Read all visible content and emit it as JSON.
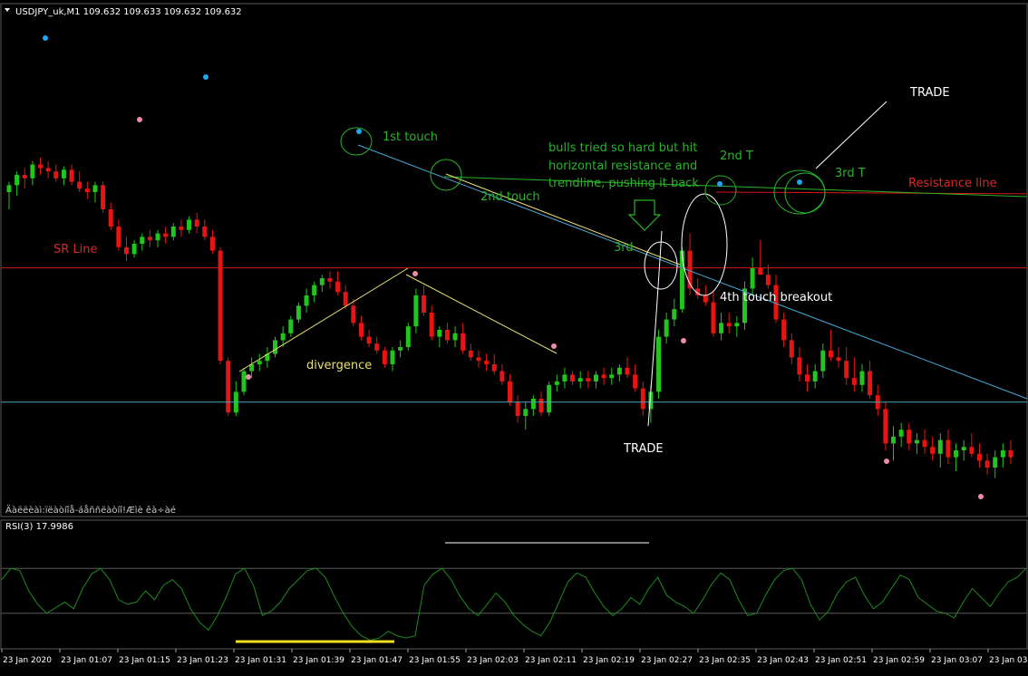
{
  "header": {
    "title": "USDJPY_uk,M1  109.632 109.633 109.632 109.632",
    "footer_text": "Äàëëèàì:ïëàòíîå-áåññëàòíî!Æìè êà÷àé"
  },
  "indicator": {
    "title": "RSI(3) 17.9986",
    "levels": [
      70,
      30
    ]
  },
  "time_axis": {
    "labels": [
      "23 Jan 2020",
      "23 Jan 01:07",
      "23 Jan 01:15",
      "23 Jan 01:23",
      "23 Jan 01:31",
      "23 Jan 01:39",
      "23 Jan 01:47",
      "23 Jan 01:55",
      "23 Jan 02:03",
      "23 Jan 02:11",
      "23 Jan 02:19",
      "23 Jan 02:27",
      "23 Jan 02:35",
      "23 Jan 02:43",
      "23 Jan 02:51",
      "23 Jan 02:59",
      "23 Jan 03:07",
      "23 Jan 03:"
    ]
  },
  "annotations": {
    "sr_line": "SR Line",
    "resistance_line": "Resistance line",
    "touch_1": "1st touch",
    "touch_2": "2nd touch",
    "touch_3": "3rd",
    "touch_2t": "2nd T",
    "touch_3t": "3rd T",
    "bulls_note": [
      "bulls tried so hard but hit",
      "horizontal resistance and",
      "trendline, pushing it back"
    ],
    "breakout": "4th touch breakout",
    "divergence": "divergence",
    "trade_top": "TRADE",
    "trade_bottom": "TRADE"
  },
  "colors": {
    "background": "#000000",
    "bull_candle": "#22c41e",
    "bear_candle": "#e81414",
    "sr_line": "#d81818",
    "trendline": "#4aa8d8",
    "divergence_line": "#e8e070",
    "annotation_green": "#28b428",
    "annotation_red": "#d82828",
    "annotation_yellow": "#e8e070",
    "annotation_white": "#ffffff",
    "rsi_line": "#1e8a1e",
    "fractal_up": "#1ea8f0",
    "fractal_down": "#f08ca8"
  },
  "chart_data": {
    "type": "candlestick",
    "symbol": "USDJPY_uk",
    "timeframe": "M1",
    "candles": [
      {
        "o": 40,
        "h": 46,
        "l": 30,
        "c": 44
      },
      {
        "o": 44,
        "h": 52,
        "l": 38,
        "c": 50
      },
      {
        "o": 50,
        "h": 54,
        "l": 42,
        "c": 48
      },
      {
        "o": 48,
        "h": 58,
        "l": 44,
        "c": 56
      },
      {
        "o": 56,
        "h": 60,
        "l": 50,
        "c": 54
      },
      {
        "o": 54,
        "h": 58,
        "l": 48,
        "c": 52
      },
      {
        "o": 52,
        "h": 56,
        "l": 46,
        "c": 48
      },
      {
        "o": 48,
        "h": 55,
        "l": 44,
        "c": 53
      },
      {
        "o": 53,
        "h": 56,
        "l": 44,
        "c": 46
      },
      {
        "o": 46,
        "h": 52,
        "l": 40,
        "c": 42
      },
      {
        "o": 42,
        "h": 46,
        "l": 36,
        "c": 40
      },
      {
        "o": 40,
        "h": 46,
        "l": 34,
        "c": 44
      },
      {
        "o": 44,
        "h": 46,
        "l": 28,
        "c": 30
      },
      {
        "o": 30,
        "h": 34,
        "l": 18,
        "c": 20
      },
      {
        "o": 20,
        "h": 24,
        "l": 6,
        "c": 8
      },
      {
        "o": 8,
        "h": 14,
        "l": 0,
        "c": 4
      },
      {
        "o": 4,
        "h": 12,
        "l": 2,
        "c": 10
      },
      {
        "o": 10,
        "h": 16,
        "l": 6,
        "c": 14
      },
      {
        "o": 14,
        "h": 18,
        "l": 8,
        "c": 12
      },
      {
        "o": 12,
        "h": 18,
        "l": 8,
        "c": 16
      },
      {
        "o": 16,
        "h": 20,
        "l": 10,
        "c": 14
      },
      {
        "o": 14,
        "h": 22,
        "l": 12,
        "c": 20
      },
      {
        "o": 20,
        "h": 24,
        "l": 14,
        "c": 18
      },
      {
        "o": 18,
        "h": 26,
        "l": 16,
        "c": 24
      },
      {
        "o": 24,
        "h": 28,
        "l": 16,
        "c": 20
      },
      {
        "o": 20,
        "h": 24,
        "l": 12,
        "c": 14
      },
      {
        "o": 14,
        "h": 18,
        "l": 4,
        "c": 6
      },
      {
        "o": 6,
        "h": 8,
        "l": -60,
        "c": -58
      },
      {
        "o": -58,
        "h": -56,
        "l": -90,
        "c": -88
      },
      {
        "o": -88,
        "h": -70,
        "l": -90,
        "c": -76
      },
      {
        "o": -76,
        "h": -62,
        "l": -78,
        "c": -64
      },
      {
        "o": -64,
        "h": -56,
        "l": -68,
        "c": -60
      },
      {
        "o": -60,
        "h": -54,
        "l": -64,
        "c": -58
      },
      {
        "o": -58,
        "h": -50,
        "l": -62,
        "c": -54
      },
      {
        "o": -54,
        "h": -44,
        "l": -56,
        "c": -46
      },
      {
        "o": -46,
        "h": -38,
        "l": -50,
        "c": -42
      },
      {
        "o": -42,
        "h": -32,
        "l": -44,
        "c": -34
      },
      {
        "o": -34,
        "h": -24,
        "l": -36,
        "c": -26
      },
      {
        "o": -26,
        "h": -16,
        "l": -30,
        "c": -20
      },
      {
        "o": -20,
        "h": -12,
        "l": -24,
        "c": -14
      },
      {
        "o": -14,
        "h": -8,
        "l": -18,
        "c": -10
      },
      {
        "o": -10,
        "h": -6,
        "l": -16,
        "c": -12
      },
      {
        "o": -12,
        "h": -6,
        "l": -20,
        "c": -18
      },
      {
        "o": -18,
        "h": -14,
        "l": -28,
        "c": -26
      },
      {
        "o": -26,
        "h": -22,
        "l": -38,
        "c": -36
      },
      {
        "o": -36,
        "h": -32,
        "l": -46,
        "c": -44
      },
      {
        "o": -44,
        "h": -40,
        "l": -50,
        "c": -48
      },
      {
        "o": -48,
        "h": -44,
        "l": -54,
        "c": -52
      },
      {
        "o": -52,
        "h": -50,
        "l": -62,
        "c": -60
      },
      {
        "o": -60,
        "h": -50,
        "l": -64,
        "c": -52
      },
      {
        "o": -52,
        "h": -46,
        "l": -56,
        "c": -50
      },
      {
        "o": -50,
        "h": -36,
        "l": -52,
        "c": -38
      },
      {
        "o": -38,
        "h": -16,
        "l": -42,
        "c": -20
      },
      {
        "o": -20,
        "h": -14,
        "l": -32,
        "c": -30
      },
      {
        "o": -30,
        "h": -26,
        "l": -46,
        "c": -44
      },
      {
        "o": -44,
        "h": -38,
        "l": -50,
        "c": -40
      },
      {
        "o": -40,
        "h": -36,
        "l": -48,
        "c": -46
      },
      {
        "o": -46,
        "h": -38,
        "l": -50,
        "c": -42
      },
      {
        "o": -42,
        "h": -36,
        "l": -54,
        "c": -52
      },
      {
        "o": -52,
        "h": -48,
        "l": -58,
        "c": -56
      },
      {
        "o": -56,
        "h": -52,
        "l": -62,
        "c": -58
      },
      {
        "o": -58,
        "h": -54,
        "l": -64,
        "c": -60
      },
      {
        "o": -60,
        "h": -54,
        "l": -66,
        "c": -64
      },
      {
        "o": -64,
        "h": -60,
        "l": -72,
        "c": -70
      },
      {
        "o": -70,
        "h": -66,
        "l": -84,
        "c": -82
      },
      {
        "o": -82,
        "h": -78,
        "l": -94,
        "c": -90
      },
      {
        "o": -90,
        "h": -82,
        "l": -98,
        "c": -86
      },
      {
        "o": -86,
        "h": -78,
        "l": -90,
        "c": -80
      },
      {
        "o": -80,
        "h": -76,
        "l": -90,
        "c": -88
      },
      {
        "o": -88,
        "h": -70,
        "l": -90,
        "c": -72
      },
      {
        "o": -72,
        "h": -66,
        "l": -76,
        "c": -70
      },
      {
        "o": -70,
        "h": -62,
        "l": -74,
        "c": -66
      },
      {
        "o": -66,
        "h": -64,
        "l": -72,
        "c": -70
      },
      {
        "o": -70,
        "h": -64,
        "l": -74,
        "c": -68
      },
      {
        "o": -68,
        "h": -64,
        "l": -74,
        "c": -70
      },
      {
        "o": -70,
        "h": -64,
        "l": -74,
        "c": -66
      },
      {
        "o": -66,
        "h": -62,
        "l": -72,
        "c": -68
      },
      {
        "o": -68,
        "h": -62,
        "l": -72,
        "c": -66
      },
      {
        "o": -66,
        "h": -60,
        "l": -70,
        "c": -62
      },
      {
        "o": -62,
        "h": -56,
        "l": -68,
        "c": -66
      },
      {
        "o": -66,
        "h": -60,
        "l": -76,
        "c": -74
      },
      {
        "o": -74,
        "h": -70,
        "l": -90,
        "c": -86
      },
      {
        "o": -86,
        "h": -72,
        "l": -94,
        "c": -76
      },
      {
        "o": -76,
        "h": -40,
        "l": -80,
        "c": -44
      },
      {
        "o": -44,
        "h": -30,
        "l": -48,
        "c": -34
      },
      {
        "o": -34,
        "h": -22,
        "l": -38,
        "c": -28
      },
      {
        "o": -28,
        "h": 8,
        "l": -30,
        "c": 6
      },
      {
        "o": 6,
        "h": 16,
        "l": -20,
        "c": -16
      },
      {
        "o": -16,
        "h": -10,
        "l": -22,
        "c": -20
      },
      {
        "o": -20,
        "h": -14,
        "l": -26,
        "c": -24
      },
      {
        "o": -24,
        "h": -18,
        "l": -44,
        "c": -42
      },
      {
        "o": -42,
        "h": -30,
        "l": -46,
        "c": -36
      },
      {
        "o": -36,
        "h": -30,
        "l": -42,
        "c": -38
      },
      {
        "o": -38,
        "h": -32,
        "l": -44,
        "c": -36
      },
      {
        "o": -36,
        "h": -12,
        "l": -40,
        "c": -16
      },
      {
        "o": -16,
        "h": 2,
        "l": -20,
        "c": -4
      },
      {
        "o": -4,
        "h": 12,
        "l": -8,
        "c": -8
      },
      {
        "o": -8,
        "h": -2,
        "l": -16,
        "c": -14
      },
      {
        "o": -14,
        "h": -8,
        "l": -36,
        "c": -34
      },
      {
        "o": -34,
        "h": -30,
        "l": -50,
        "c": -46
      },
      {
        "o": -46,
        "h": -42,
        "l": -60,
        "c": -56
      },
      {
        "o": -56,
        "h": -50,
        "l": -70,
        "c": -66
      },
      {
        "o": -66,
        "h": -60,
        "l": -76,
        "c": -70
      },
      {
        "o": -70,
        "h": -60,
        "l": -74,
        "c": -64
      },
      {
        "o": -64,
        "h": -48,
        "l": -68,
        "c": -52
      },
      {
        "o": -52,
        "h": -40,
        "l": -58,
        "c": -56
      },
      {
        "o": -56,
        "h": -50,
        "l": -62,
        "c": -58
      },
      {
        "o": -58,
        "h": -50,
        "l": -72,
        "c": -68
      },
      {
        "o": -68,
        "h": -56,
        "l": -76,
        "c": -72
      },
      {
        "o": -72,
        "h": -60,
        "l": -76,
        "c": -64
      },
      {
        "o": -64,
        "h": -58,
        "l": -80,
        "c": -78
      },
      {
        "o": -78,
        "h": -72,
        "l": -90,
        "c": -86
      },
      {
        "o": -86,
        "h": -82,
        "l": -110,
        "c": -106
      },
      {
        "o": -106,
        "h": -96,
        "l": -116,
        "c": -102
      },
      {
        "o": -102,
        "h": -94,
        "l": -108,
        "c": -98
      },
      {
        "o": -98,
        "h": -94,
        "l": -110,
        "c": -106
      },
      {
        "o": -106,
        "h": -100,
        "l": -112,
        "c": -104
      },
      {
        "o": -104,
        "h": -98,
        "l": -112,
        "c": -108
      },
      {
        "o": -108,
        "h": -102,
        "l": -116,
        "c": -112
      },
      {
        "o": -112,
        "h": -100,
        "l": -120,
        "c": -104
      },
      {
        "o": -104,
        "h": -98,
        "l": -118,
        "c": -114
      },
      {
        "o": -114,
        "h": -106,
        "l": -122,
        "c": -110
      },
      {
        "o": -110,
        "h": -104,
        "l": -116,
        "c": -108
      },
      {
        "o": -108,
        "h": -100,
        "l": -114,
        "c": -112
      },
      {
        "o": -112,
        "h": -106,
        "l": -120,
        "c": -116
      },
      {
        "o": -116,
        "h": -112,
        "l": -124,
        "c": -120
      },
      {
        "o": -120,
        "h": -110,
        "l": -126,
        "c": -114
      },
      {
        "o": -114,
        "h": -106,
        "l": -120,
        "c": -110
      },
      {
        "o": -110,
        "h": -104,
        "l": -118,
        "c": -114
      }
    ],
    "rsi": [
      60,
      70,
      68,
      50,
      38,
      30,
      35,
      40,
      34,
      52,
      65,
      70,
      60,
      42,
      38,
      40,
      50,
      42,
      55,
      60,
      52,
      34,
      22,
      15,
      28,
      45,
      65,
      70,
      55,
      28,
      32,
      40,
      52,
      60,
      68,
      70,
      62,
      45,
      30,
      18,
      10,
      6,
      8,
      14,
      10,
      8,
      10,
      55,
      65,
      70,
      60,
      45,
      34,
      28,
      38,
      48,
      40,
      28,
      20,
      14,
      10,
      22,
      40,
      58,
      66,
      62,
      48,
      36,
      28,
      34,
      44,
      38,
      52,
      62,
      46,
      40,
      36,
      30,
      42,
      56,
      66,
      60,
      42,
      28,
      30,
      46,
      60,
      68,
      70,
      60,
      38,
      24,
      32,
      48,
      58,
      62,
      46,
      34,
      40,
      52,
      64,
      60,
      44,
      38,
      32,
      30,
      26,
      40,
      52,
      44,
      36,
      48,
      58,
      62,
      70
    ]
  }
}
